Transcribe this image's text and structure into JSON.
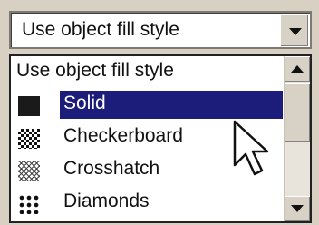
{
  "combo": {
    "value": "Use object fill style",
    "button_icon": "chevron-down-icon"
  },
  "list": {
    "header": "Use object fill style",
    "items": [
      {
        "label": "Solid",
        "swatch": "solid",
        "selected": true
      },
      {
        "label": "Checkerboard",
        "swatch": "checkerboard",
        "selected": false
      },
      {
        "label": "Crosshatch",
        "swatch": "crosshatch",
        "selected": false
      },
      {
        "label": "Diamonds",
        "swatch": "diamonds",
        "selected": false
      }
    ]
  },
  "colors": {
    "selection": "#1c1c7a",
    "window_bg": "#d7d0c3"
  },
  "cursor": {
    "icon": "arrow-pointer-icon"
  }
}
